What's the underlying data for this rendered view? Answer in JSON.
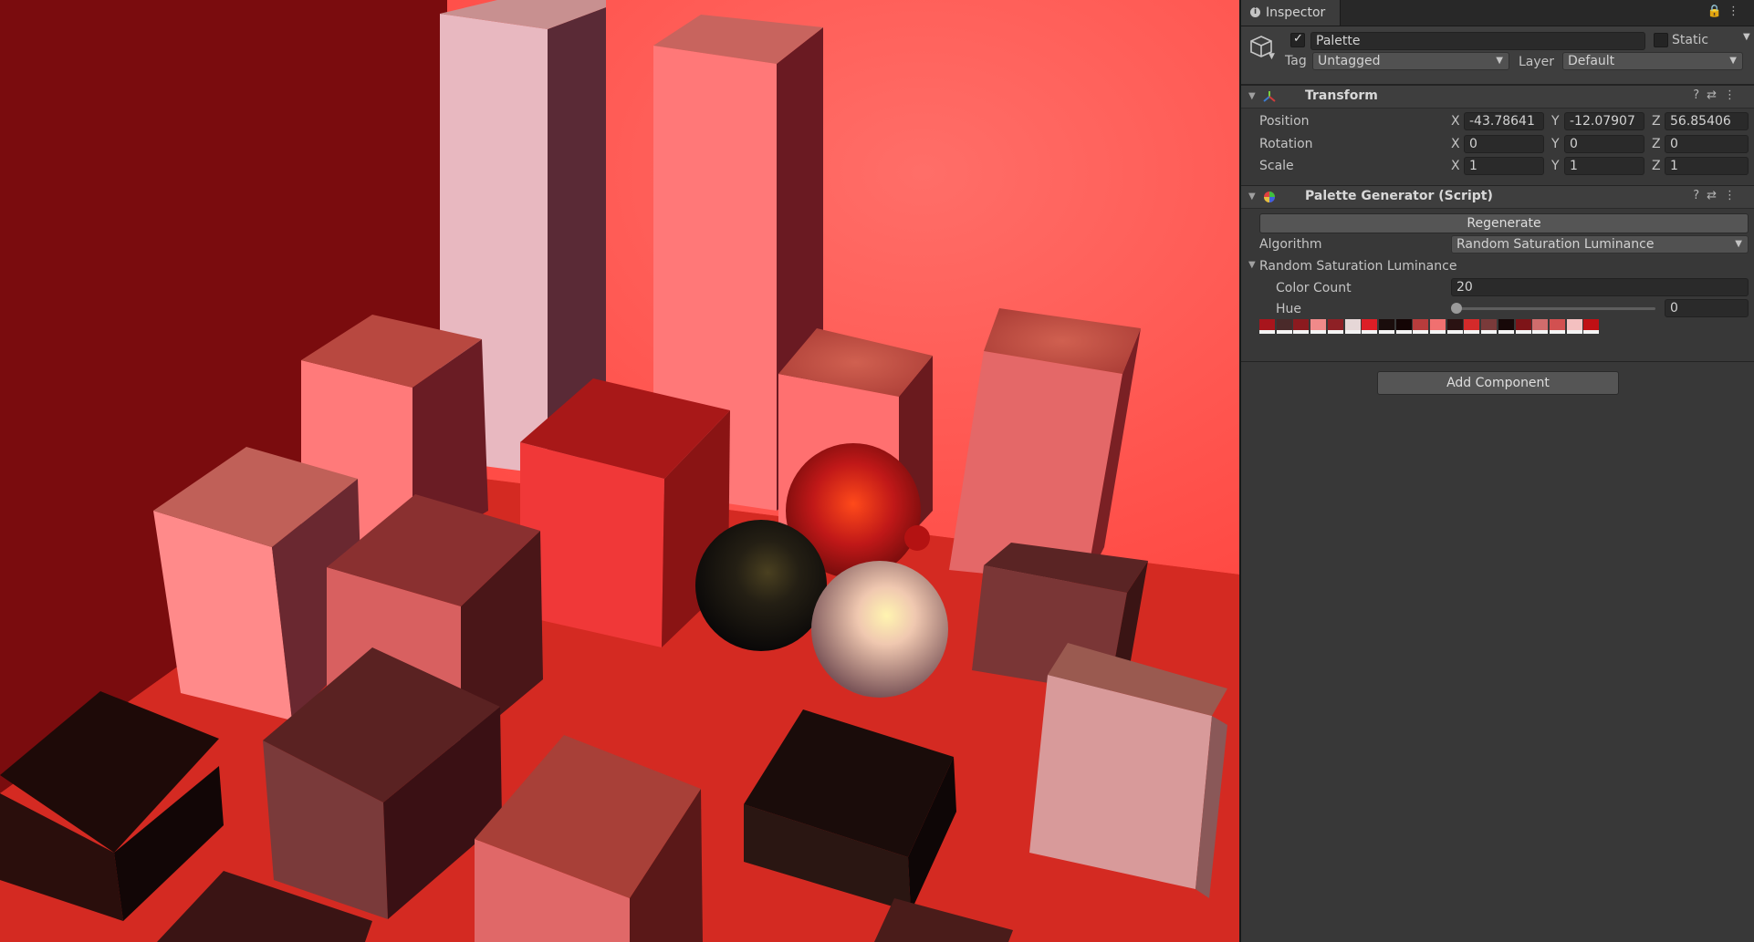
{
  "window": {
    "tab_label": "Inspector",
    "tab_icons": "🔒⋮"
  },
  "object": {
    "active": true,
    "name": "Palette",
    "static_label": "Static",
    "tag_label": "Tag",
    "tag_value": "Untagged",
    "layer_label": "Layer",
    "layer_value": "Default"
  },
  "transform": {
    "title": "Transform",
    "position_label": "Position",
    "rotation_label": "Rotation",
    "scale_label": "Scale",
    "axis_x": "X",
    "axis_y": "Y",
    "axis_z": "Z",
    "position": [
      "-43.78641",
      "-12.07907",
      "56.85406"
    ],
    "rotation": [
      "0",
      "0",
      "0"
    ],
    "scale": [
      "1",
      "1",
      "1"
    ]
  },
  "palette_generator": {
    "title": "Palette Generator (Script)",
    "regenerate_label": "Regenerate",
    "algorithm_label": "Algorithm",
    "algorithm_value": "Random Saturation Luminance",
    "section_label": "Random Saturation Luminance",
    "color_count_label": "Color Count",
    "color_count_value": "20",
    "hue_label": "Hue",
    "hue_value": "0",
    "hue_level": 0,
    "swatches": [
      "#a8151c",
      "#4a2a2a",
      "#8c1a1f",
      "#f08a8a",
      "#8e2025",
      "#e6d7d7",
      "#dc1e26",
      "#1a0d0c",
      "#140505",
      "#b83c3c",
      "#f07070",
      "#2a1212",
      "#d42a2a",
      "#7a3a3a",
      "#170808",
      "#7e1418",
      "#d06c6c",
      "#d25050",
      "#f4c0c0",
      "#c01014"
    ]
  },
  "footer": {
    "add_component_label": "Add Component"
  },
  "icons": {
    "info": "info-icon",
    "lock": "lock-icon",
    "menu": "kebab-menu-icon",
    "gameobject": "cube-icon",
    "transform": "transform-axes-icon",
    "script": "color-wheel-icon",
    "help": "help-icon",
    "presets": "presets-icon"
  },
  "scene": {
    "background_color": "#e8362c",
    "floor_color": "#d42a22",
    "left_wall_color": "#7a0c0e",
    "back_wall_color": "#ff4f4a"
  }
}
